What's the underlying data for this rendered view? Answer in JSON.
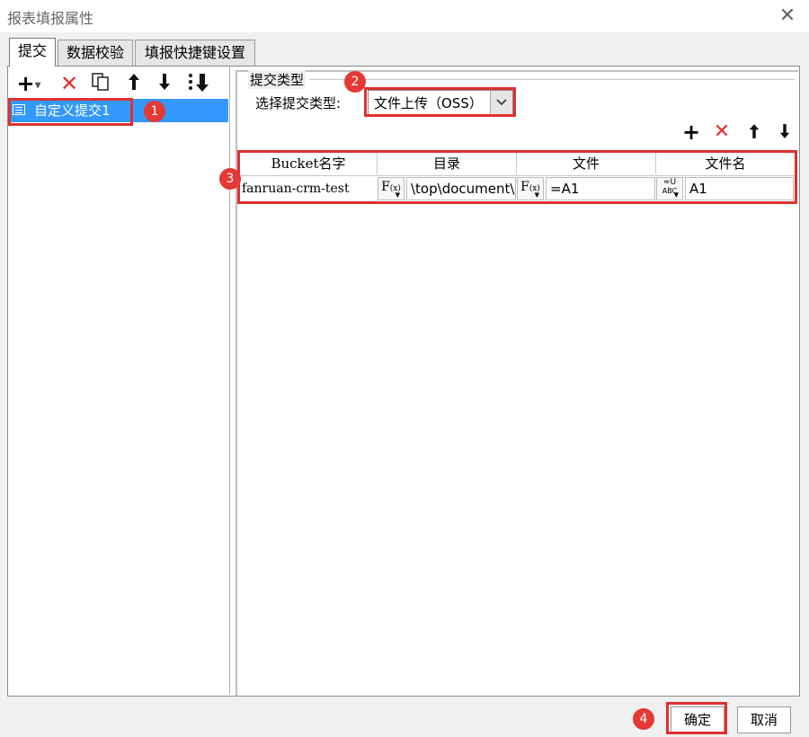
{
  "window": {
    "title": "报表填报属性"
  },
  "tabs": [
    {
      "label": "提交"
    },
    {
      "label": "数据校验"
    },
    {
      "label": "填报快捷键设置"
    }
  ],
  "left_toolbar": {
    "icons": [
      "add-dropdown-icon",
      "delete-icon",
      "copy-icon",
      "move-up-icon",
      "move-down-icon",
      "move-bottom-icon"
    ]
  },
  "tree": {
    "items": [
      {
        "label": "自定义提交1",
        "selected": true
      }
    ]
  },
  "submit_type": {
    "section_title": "提交类型",
    "select_label": "选择提交类型:",
    "selected": "文件上传（OSS）"
  },
  "right_toolbar": {
    "icons": [
      "add-icon",
      "delete-icon",
      "move-up-icon",
      "move-down-icon"
    ]
  },
  "table": {
    "headers": [
      "Bucket名字",
      "目录",
      "文件",
      "文件名"
    ],
    "row": {
      "bucket": "fanruan-crm-test",
      "directory": "\\top\\document\\",
      "file": "=A1",
      "filename": "A1"
    },
    "fx_label": "F",
    "fx_sub": "(x)",
    "abc_label": "ABC"
  },
  "badges": [
    "1",
    "2",
    "3",
    "4"
  ],
  "buttons": {
    "ok": "确定",
    "cancel": "取消"
  },
  "colors": {
    "highlight_red": "#e03030",
    "selection_blue": "#3399ff",
    "badge_red": "#e53935"
  }
}
